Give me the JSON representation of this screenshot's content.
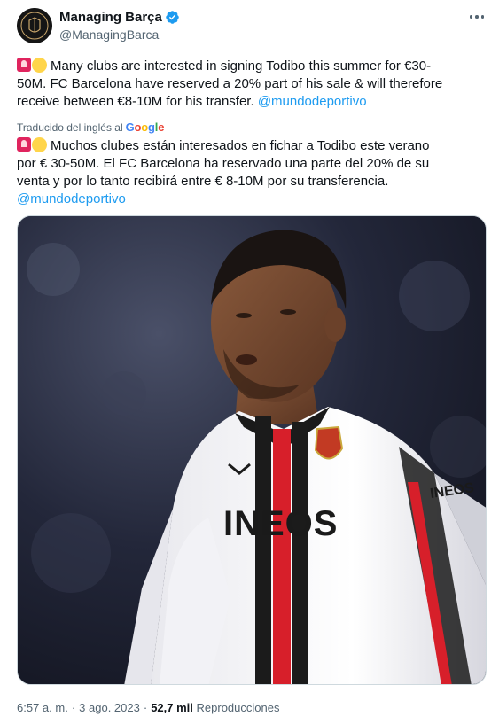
{
  "author": {
    "name": "Managing Barça",
    "handle": "@ManagingBarca",
    "avatar_text": "MANAGING BARÇA",
    "verified_icon": "verified-badge-icon"
  },
  "more_icon": "more-horizontal-icon",
  "tweet_en": {
    "line1": "Many clubs are interested in signing Todibo this summer for €30-",
    "line2": "50M. FC Barcelona have reserved a 20% part of his sale & will therefore",
    "line3_text": "receive between €8-10M for his transfer. ",
    "mention": "@mundodeportivo"
  },
  "translation": {
    "label": "Traducido del inglés al",
    "provider": "Google"
  },
  "tweet_es": {
    "line1": "Muchos clubes están interesados en fichar a Todibo este verano",
    "line2": "por € 30-50M. El FC Barcelona ha reservado una parte del 20% de su",
    "line3": "venta y por lo tanto recibirá entre € 8-10M por su transferencia.",
    "mention": "@mundodeportivo"
  },
  "emojis": [
    "police-light-emoji",
    "yellow-circle-emoji"
  ],
  "media": {
    "shirt_sponsor": "INEOS",
    "sleeve_sponsor": "INEOS"
  },
  "meta": {
    "time": "6:57 a. m.",
    "separator": "·",
    "date": "3 ago. 2023",
    "views_count": "52,7 mil",
    "views_label": "Reproducciones"
  },
  "colors": {
    "link": "#1d9bf0",
    "secondary_text": "#536471",
    "primary_text": "#0f1419",
    "verified": "#1d9bf0"
  }
}
